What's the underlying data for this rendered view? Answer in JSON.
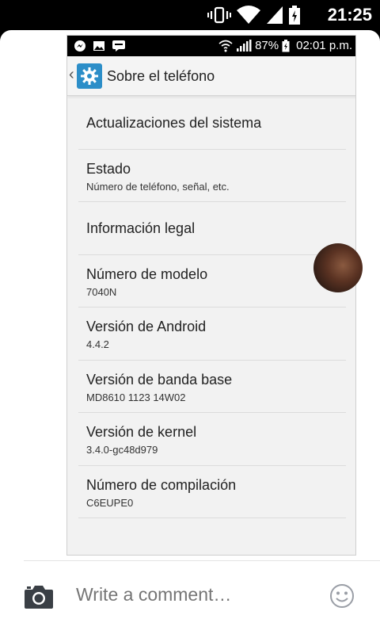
{
  "outer_status": {
    "time": "21:25"
  },
  "screenshot": {
    "status": {
      "battery": "87%",
      "time": "02:01 p.m."
    },
    "header": {
      "title": "Sobre el teléfono"
    },
    "items": [
      {
        "title": "Actualizaciones del sistema",
        "subtitle": ""
      },
      {
        "title": "Estado",
        "subtitle": "Número de teléfono, señal, etc."
      },
      {
        "title": "Información legal",
        "subtitle": ""
      },
      {
        "title": "Número de modelo",
        "subtitle": "7040N"
      },
      {
        "title": "Versión de Android",
        "subtitle": "4.4.2"
      },
      {
        "title": "Versión de banda base",
        "subtitle": "MD8610 1123 14W02"
      },
      {
        "title": "Versión de kernel",
        "subtitle": "3.4.0-gc48d979"
      },
      {
        "title": "Número de compilación",
        "subtitle": "C6EUPE0"
      }
    ]
  },
  "comment_bar": {
    "placeholder": "Write a comment…"
  },
  "colors": {
    "accent": "#2c8ec8",
    "placeholder": "#9a9ea6"
  },
  "icons": [
    "vibrate-icon",
    "wifi-icon",
    "signal-icon",
    "battery-icon",
    "messenger-icon",
    "image-icon",
    "chat-icon",
    "settings-gear-icon",
    "camera-icon",
    "smiley-icon"
  ]
}
